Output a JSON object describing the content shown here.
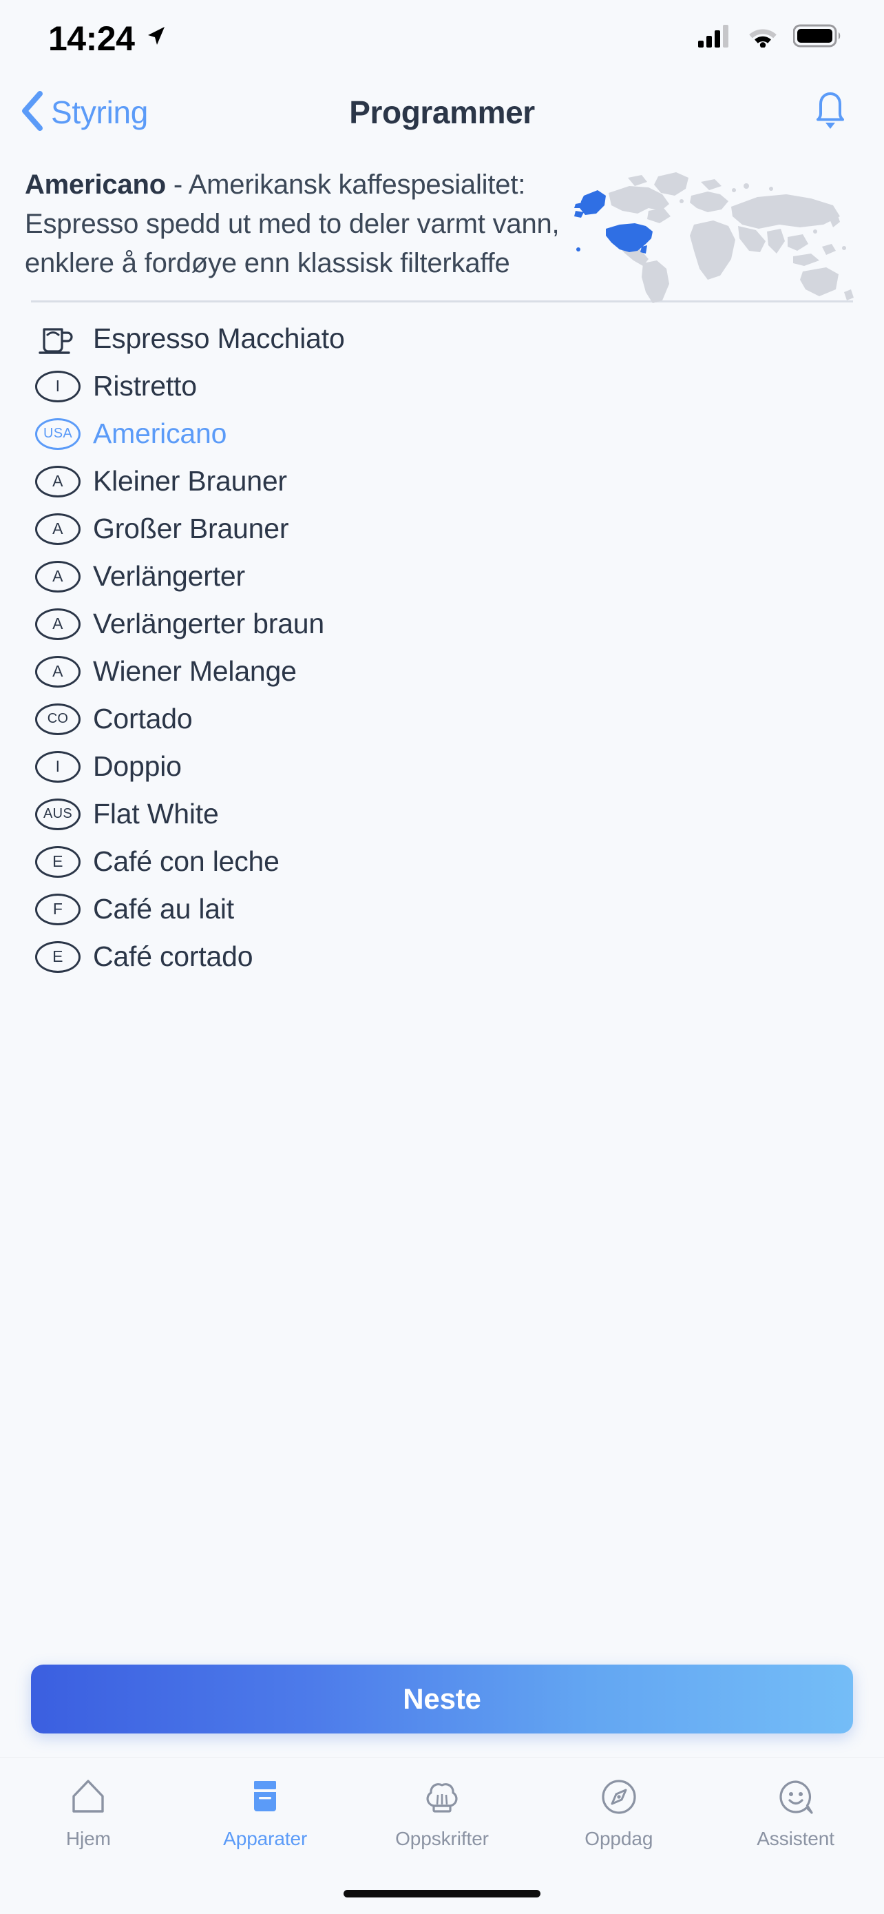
{
  "status_bar": {
    "time": "14:24",
    "location_icon": "location-arrow-icon",
    "cellular_icon": "cellular-signal-icon",
    "wifi_icon": "wifi-icon",
    "battery_icon": "battery-full-icon"
  },
  "nav": {
    "back_label": "Styring",
    "back_icon": "chevron-left-icon",
    "title": "Programmer",
    "bell_icon": "bell-icon"
  },
  "hero": {
    "name": "Americano",
    "separator": " - ",
    "description": "Amerikansk kaffespesialitet: Espresso spedd ut med to deler varmt vann, enklere å fordøye enn klassisk filterkaffe",
    "map_icon": "world-map-usa-highlighted",
    "map_highlight_color": "#2f6fe4",
    "map_base_color": "#d3d6dd"
  },
  "list": {
    "items": [
      {
        "badge": "cup-icon",
        "badge_type": "icon",
        "label": "Espresso Macchiato",
        "selected": false
      },
      {
        "badge": "I",
        "badge_type": "oval",
        "label": "Ristretto",
        "selected": false
      },
      {
        "badge": "USA",
        "badge_type": "oval",
        "label": "Americano",
        "selected": true
      },
      {
        "badge": "A",
        "badge_type": "oval",
        "label": "Kleiner Brauner",
        "selected": false
      },
      {
        "badge": "A",
        "badge_type": "oval",
        "label": "Großer Brauner",
        "selected": false
      },
      {
        "badge": "A",
        "badge_type": "oval",
        "label": "Verlängerter",
        "selected": false
      },
      {
        "badge": "A",
        "badge_type": "oval",
        "label": "Verlängerter braun",
        "selected": false
      },
      {
        "badge": "A",
        "badge_type": "oval",
        "label": "Wiener Melange",
        "selected": false
      },
      {
        "badge": "CO",
        "badge_type": "oval",
        "label": "Cortado",
        "selected": false
      },
      {
        "badge": "I",
        "badge_type": "oval",
        "label": "Doppio",
        "selected": false
      },
      {
        "badge": "AUS",
        "badge_type": "oval",
        "label": "Flat White",
        "selected": false
      },
      {
        "badge": "E",
        "badge_type": "oval",
        "label": "Café con leche",
        "selected": false
      },
      {
        "badge": "F",
        "badge_type": "oval",
        "label": "Café au lait",
        "selected": false
      },
      {
        "badge": "E",
        "badge_type": "oval",
        "label": "Café cortado",
        "selected": false
      }
    ]
  },
  "cta": {
    "label": "Neste",
    "gradient_from": "#3b5fe0",
    "gradient_to": "#74bdf7"
  },
  "tabbar": {
    "active_color": "#5b9bf8",
    "inactive_color": "#8b93a3",
    "items": [
      {
        "label": "Hjem",
        "icon": "home-icon",
        "active": false
      },
      {
        "label": "Apparater",
        "icon": "appliance-icon",
        "active": true
      },
      {
        "label": "Oppskrifter",
        "icon": "chef-hat-icon",
        "active": false
      },
      {
        "label": "Oppdag",
        "icon": "compass-icon",
        "active": false
      },
      {
        "label": "Assistent",
        "icon": "smiley-chat-icon",
        "active": false
      }
    ]
  }
}
